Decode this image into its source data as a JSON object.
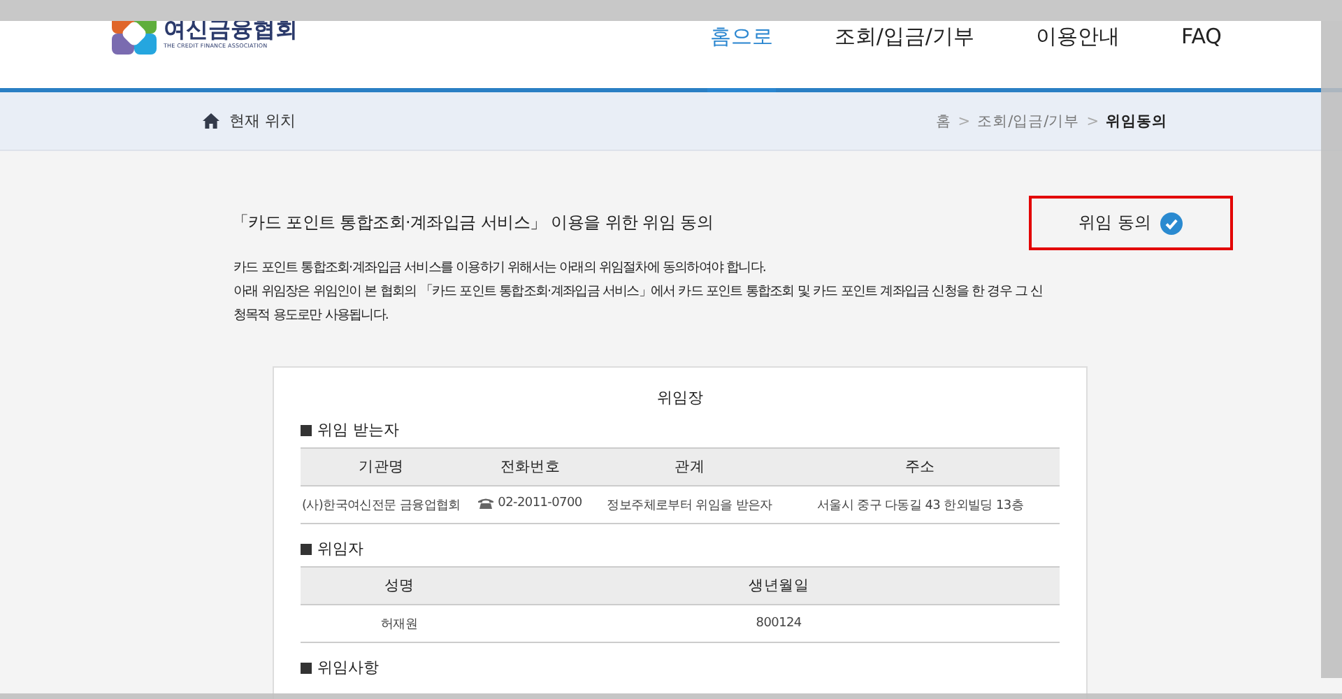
{
  "header": {
    "logo": {
      "name": "여신금융협회",
      "subtitle": "THE CREDIT FINANCE ASSOCIATION"
    },
    "nav": [
      {
        "label": "홈으로",
        "selected": true
      },
      {
        "label": "조회/입금/기부",
        "selected": false
      },
      {
        "label": "이용안내",
        "selected": false
      },
      {
        "label": "FAQ",
        "selected": false
      }
    ]
  },
  "location_bar": {
    "label": "현재 위치",
    "breadcrumb": [
      "홈",
      "조회/입금/기부",
      "위임동의"
    ],
    "separator": ">"
  },
  "title": "「카드 포인트 통합조회·계좌입금 서비스」 이용을 위한 위임 동의",
  "consent": {
    "label": "위임 동의",
    "checked": true
  },
  "description": [
    "카드 포인트 통합조회·계좌입금 서비스를 이용하기 위해서는 아래의 위임절차에 동의하여야 합니다.",
    "아래 위임장은 위임인이 본 협회의 「카드 포인트 통합조회·계좌입금 서비스」에서 카드 포인트 통합조회 및 카드 포인트 계좌입금 신청을 한 경우 그 신",
    "청목적 용도로만 사용됩니다."
  ],
  "letter": {
    "title": "위임장",
    "sections": [
      {
        "heading": "위임 받는자",
        "columns": [
          "기관명",
          "전화번호",
          "관계",
          "주소"
        ],
        "rows": [
          [
            {
              "text": "(사)한국여신전문 금융업협회"
            },
            {
              "text": "02-2011-0700",
              "kind": "phone"
            },
            {
              "text": "정보주체로부터 위임을 받은자"
            },
            {
              "text": "서울시 중구 다동길 43 한외빌딩 13층"
            }
          ]
        ]
      },
      {
        "heading": "위임자",
        "columns": [
          "성명",
          "생년월일"
        ],
        "rows": [
          [
            {
              "text": "허재원"
            },
            {
              "text": "800124"
            }
          ]
        ]
      },
      {
        "heading": "위임사항"
      }
    ]
  }
}
